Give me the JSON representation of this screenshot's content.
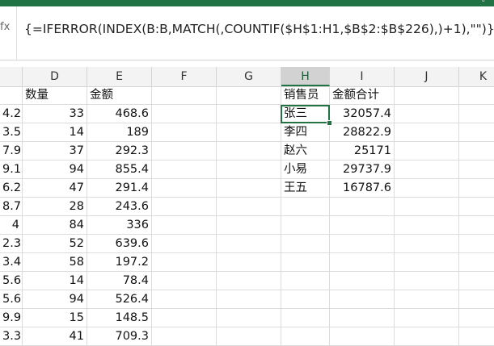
{
  "formula_bar": {
    "fx_label": "fx",
    "formula": "{=IFERROR(INDEX(B:B,MATCH(,COUNTIF($H$1:H1,$B$2:$B$226),)+1),\"\")}"
  },
  "columns": [
    "",
    "D",
    "E",
    "F",
    "G",
    "H",
    "I",
    "J",
    "K"
  ],
  "selected_column": "H",
  "rows": [
    [
      "",
      "数量",
      "金额",
      "",
      "",
      "销售员",
      "金额合计",
      "",
      ""
    ],
    [
      "4.2",
      "33",
      "468.6",
      "",
      "",
      "张三",
      "32057.4",
      "",
      ""
    ],
    [
      "3.5",
      "14",
      "189",
      "",
      "",
      "李四",
      "28822.9",
      "",
      ""
    ],
    [
      "7.9",
      "37",
      "292.3",
      "",
      "",
      "赵六",
      "25171",
      "",
      ""
    ],
    [
      "9.1",
      "94",
      "855.4",
      "",
      "",
      "小易",
      "29737.9",
      "",
      ""
    ],
    [
      "6.2",
      "47",
      "291.4",
      "",
      "",
      "王五",
      "16787.6",
      "",
      ""
    ],
    [
      "8.7",
      "28",
      "243.6",
      "",
      "",
      "",
      "",
      "",
      ""
    ],
    [
      "4",
      "84",
      "336",
      "",
      "",
      "",
      "",
      "",
      ""
    ],
    [
      "2.3",
      "52",
      "639.6",
      "",
      "",
      "",
      "",
      "",
      ""
    ],
    [
      "3.4",
      "58",
      "197.2",
      "",
      "",
      "",
      "",
      "",
      ""
    ],
    [
      "5.6",
      "14",
      "78.4",
      "",
      "",
      "",
      "",
      "",
      ""
    ],
    [
      "5.6",
      "94",
      "526.4",
      "",
      "",
      "",
      "",
      "",
      ""
    ],
    [
      "9.9",
      "15",
      "148.5",
      "",
      "",
      "",
      "",
      "",
      ""
    ],
    [
      "3.3",
      "41",
      "709.3",
      "",
      "",
      "",
      "",
      "",
      ""
    ]
  ]
}
